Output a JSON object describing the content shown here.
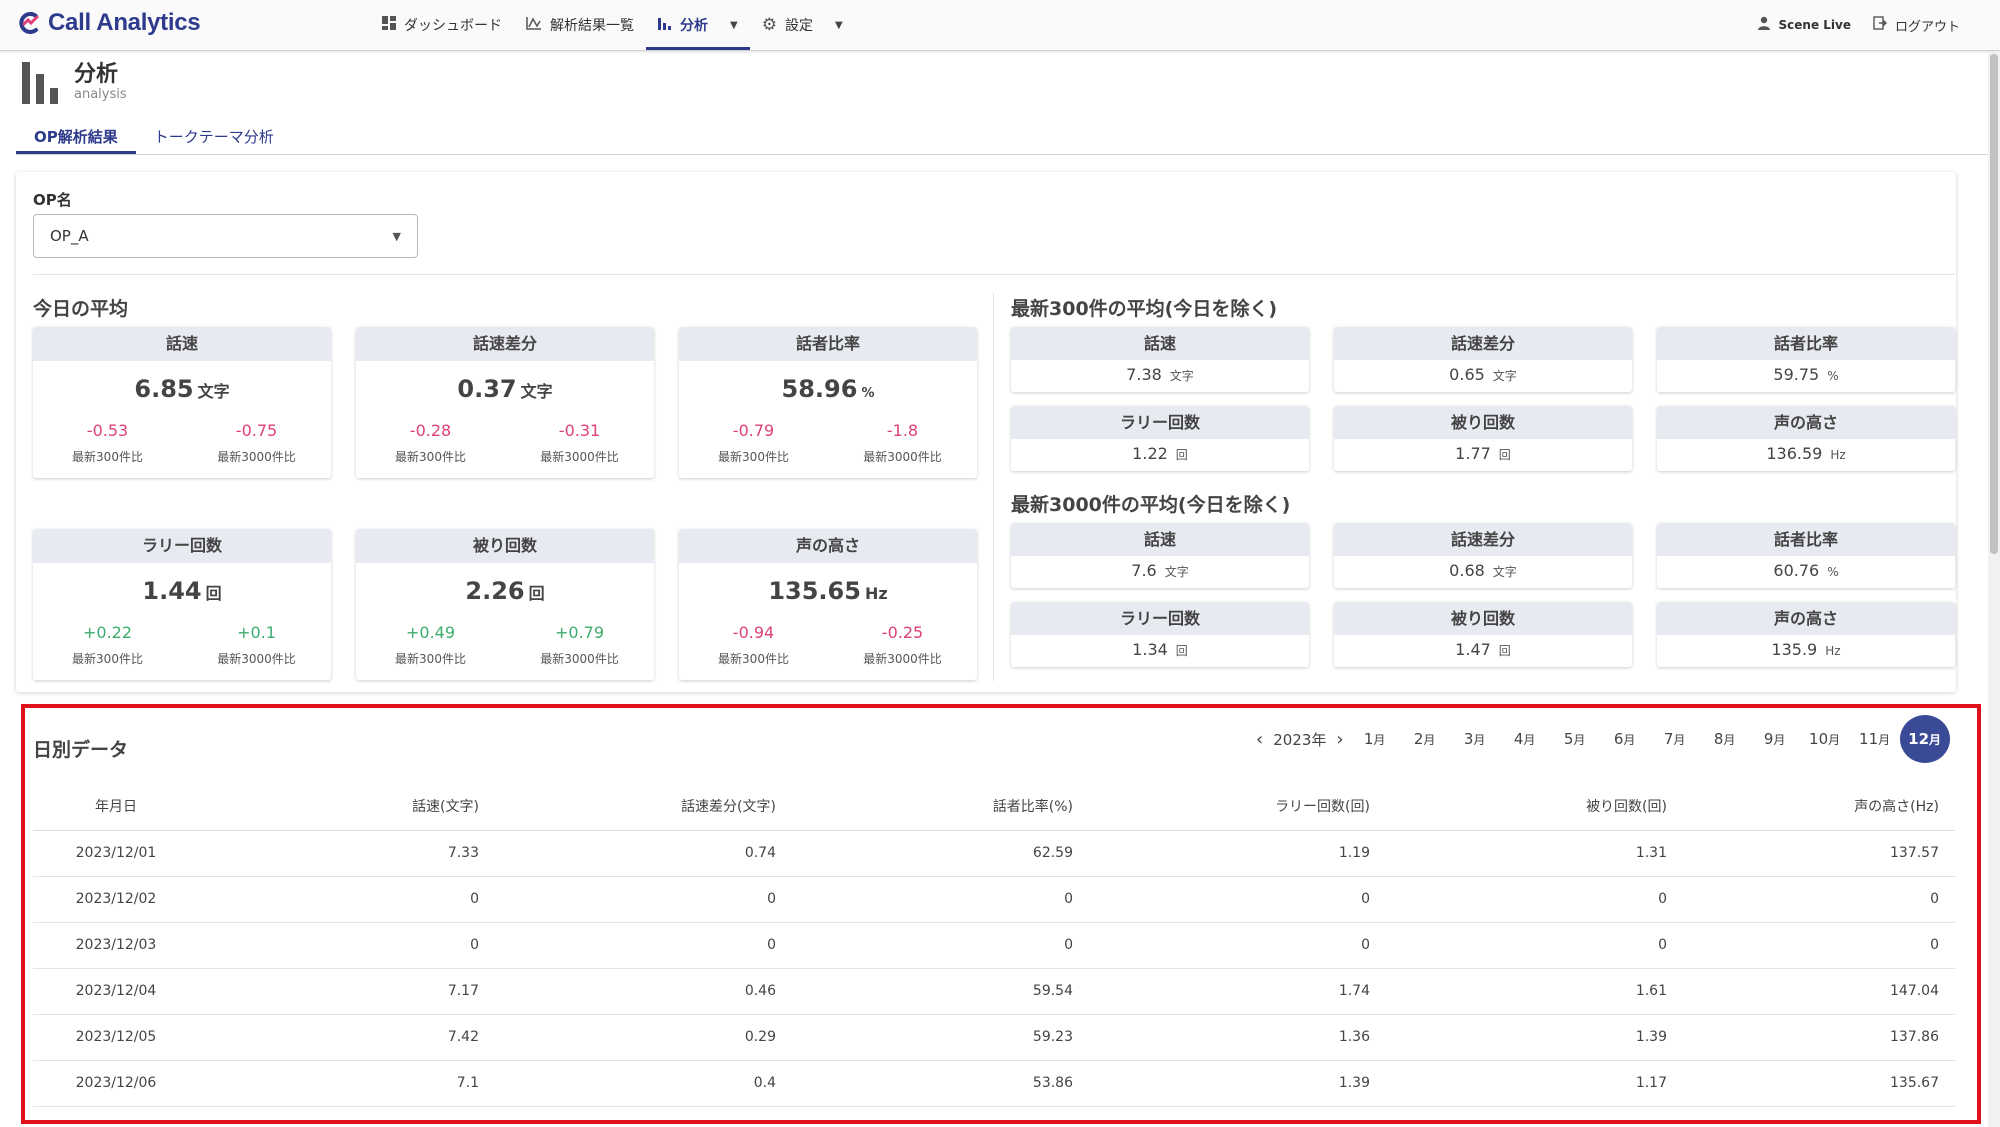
{
  "app": {
    "title": "Call Analytics"
  },
  "nav": {
    "dashboard": "ダッシュボード",
    "results": "解析結果一覧",
    "analysis": "分析",
    "settings": "設定",
    "user": "Scene Live",
    "logout": "ログアウト"
  },
  "page": {
    "title": "分析",
    "subtitle": "analysis"
  },
  "tabs": [
    "OP解析結果",
    "トークテーマ分析"
  ],
  "op": {
    "label": "OP名",
    "value": "OP_A"
  },
  "today": {
    "title": "今日の平均",
    "cards": [
      {
        "label": "話速",
        "value": "6.85",
        "unit": "文字",
        "d300": "-0.53",
        "d3000": "-0.75"
      },
      {
        "label": "話速差分",
        "value": "0.37",
        "unit": "文字",
        "d300": "-0.28",
        "d3000": "-0.31"
      },
      {
        "label": "話者比率",
        "value": "58.96",
        "unit": "%",
        "d300": "-0.79",
        "d3000": "-1.8"
      },
      {
        "label": "ラリー回数",
        "value": "1.44",
        "unit": "回",
        "d300": "+0.22",
        "d3000": "+0.1"
      },
      {
        "label": "被り回数",
        "value": "2.26",
        "unit": "回",
        "d300": "+0.49",
        "d3000": "+0.79"
      },
      {
        "label": "声の高さ",
        "value": "135.65",
        "unit": "Hz",
        "d300": "-0.94",
        "d3000": "-0.25"
      }
    ],
    "cmp300": "最新300件比",
    "cmp3000": "最新3000件比"
  },
  "latest300": {
    "title": "最新300件の平均(今日を除く)",
    "cards": [
      {
        "label": "話速",
        "value": "7.38",
        "unit": "文字"
      },
      {
        "label": "話速差分",
        "value": "0.65",
        "unit": "文字"
      },
      {
        "label": "話者比率",
        "value": "59.75",
        "unit": "%"
      },
      {
        "label": "ラリー回数",
        "value": "1.22",
        "unit": "回"
      },
      {
        "label": "被り回数",
        "value": "1.77",
        "unit": "回"
      },
      {
        "label": "声の高さ",
        "value": "136.59",
        "unit": "Hz"
      }
    ]
  },
  "latest3000": {
    "title": "最新3000件の平均(今日を除く)",
    "cards": [
      {
        "label": "話速",
        "value": "7.6",
        "unit": "文字"
      },
      {
        "label": "話速差分",
        "value": "0.68",
        "unit": "文字"
      },
      {
        "label": "話者比率",
        "value": "60.76",
        "unit": "%"
      },
      {
        "label": "ラリー回数",
        "value": "1.34",
        "unit": "回"
      },
      {
        "label": "被り回数",
        "value": "1.47",
        "unit": "回"
      },
      {
        "label": "声の高さ",
        "value": "135.9",
        "unit": "Hz"
      }
    ]
  },
  "daily": {
    "title": "日別データ",
    "year": "2023年",
    "months": [
      "1",
      "2",
      "3",
      "4",
      "5",
      "6",
      "7",
      "8",
      "9",
      "10",
      "11",
      "12"
    ],
    "month_suffix": "月",
    "selected_month": "12",
    "columns": [
      "年月日",
      "話速(文字)",
      "話速差分(文字)",
      "話者比率(%)",
      "ラリー回数(回)",
      "被り回数(回)",
      "声の高さ(Hz)"
    ],
    "rows": [
      [
        "2023/12/01",
        "7.33",
        "0.74",
        "62.59",
        "1.19",
        "1.31",
        "137.57"
      ],
      [
        "2023/12/02",
        "0",
        "0",
        "0",
        "0",
        "0",
        "0"
      ],
      [
        "2023/12/03",
        "0",
        "0",
        "0",
        "0",
        "0",
        "0"
      ],
      [
        "2023/12/04",
        "7.17",
        "0.46",
        "59.54",
        "1.74",
        "1.61",
        "147.04"
      ],
      [
        "2023/12/05",
        "7.42",
        "0.29",
        "59.23",
        "1.36",
        "1.39",
        "137.86"
      ],
      [
        "2023/12/06",
        "7.1",
        "0.4",
        "53.86",
        "1.39",
        "1.17",
        "135.67"
      ]
    ]
  },
  "colors": {
    "accent": "#2e3a8c",
    "negative": "#e0407a",
    "positive": "#3cac6c",
    "highlight_border": "#e0101a"
  }
}
